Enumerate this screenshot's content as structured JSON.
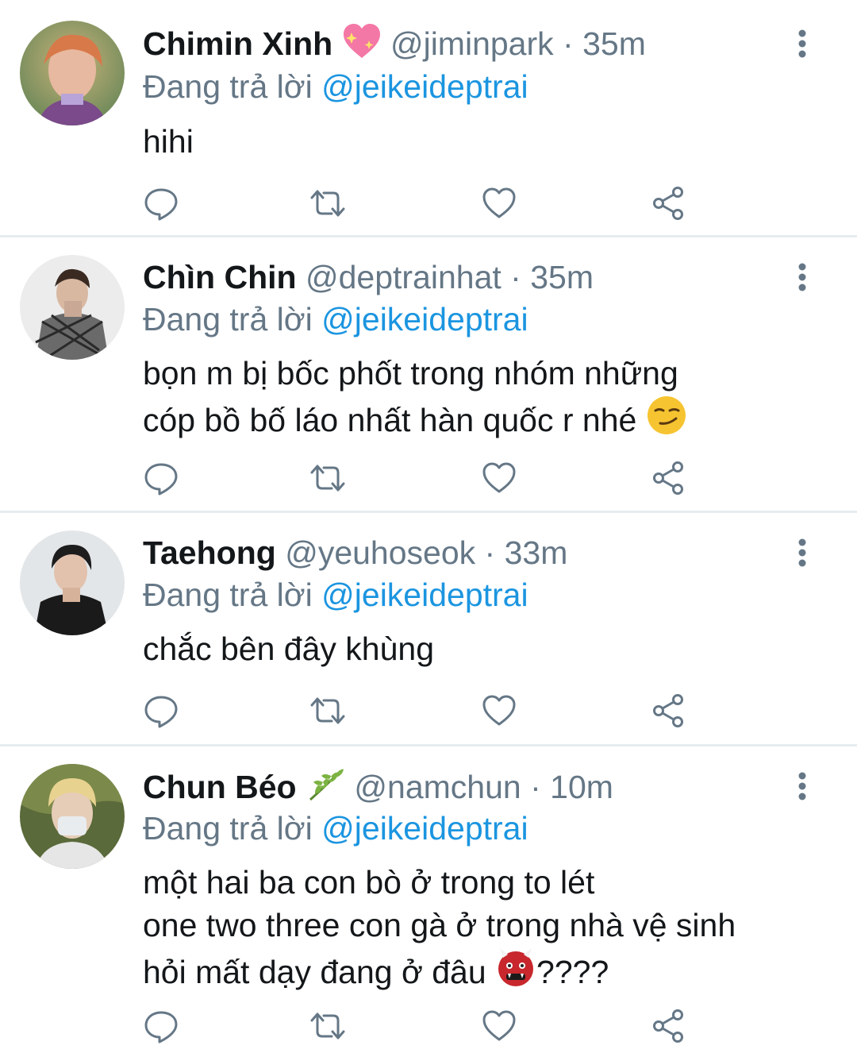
{
  "tweets": [
    {
      "display_name": "Chimin Xinh",
      "name_emoji": "sparkling-heart",
      "handle": "@jiminpark",
      "sep": "·",
      "time": "35m",
      "reply_prefix": "Đang trả lời",
      "reply_to": "@jeikeideptrai",
      "lines": [
        "hihi"
      ]
    },
    {
      "display_name": "Chìn Chin",
      "name_emoji": "",
      "handle": "@deptrainhat",
      "sep": "·",
      "time": "35m",
      "reply_prefix": "Đang trả lời",
      "reply_to": "@jeikeideptrai",
      "lines": [
        "bọn m bị bốc phốt trong nhóm những",
        "cóp bồ bố láo nhất hàn quốc r nhé"
      ],
      "trailing_emoji": "smirking-face"
    },
    {
      "display_name": "Taehong",
      "name_emoji": "",
      "handle": "@yeuhoseok",
      "sep": "·",
      "time": "33m",
      "reply_prefix": "Đang trả lời",
      "reply_to": "@jeikeideptrai",
      "lines": [
        "chắc bên đây khùng"
      ]
    },
    {
      "display_name": "Chun Béo",
      "name_emoji": "herb",
      "handle": "@namchun",
      "sep": "·",
      "time": "10m",
      "reply_prefix": "Đang trả lời",
      "reply_to": "@jeikeideptrai",
      "lines": [
        "một hai ba con bò ở trong to lét",
        "one two three con gà ở trong nhà vệ sinh",
        "hỏi mất dạy đang ở đâu"
      ],
      "line3_suffix": "????",
      "trailing_emoji": "ogre-face"
    }
  ],
  "icons": {
    "actions": [
      "reply-icon",
      "retweet-icon",
      "like-icon",
      "share-icon"
    ],
    "more": "more-vertical-icon"
  },
  "colors": {
    "text": "#14171a",
    "secondary": "#657786",
    "mention": "#1b95e0",
    "divider": "#e6ecf0"
  }
}
